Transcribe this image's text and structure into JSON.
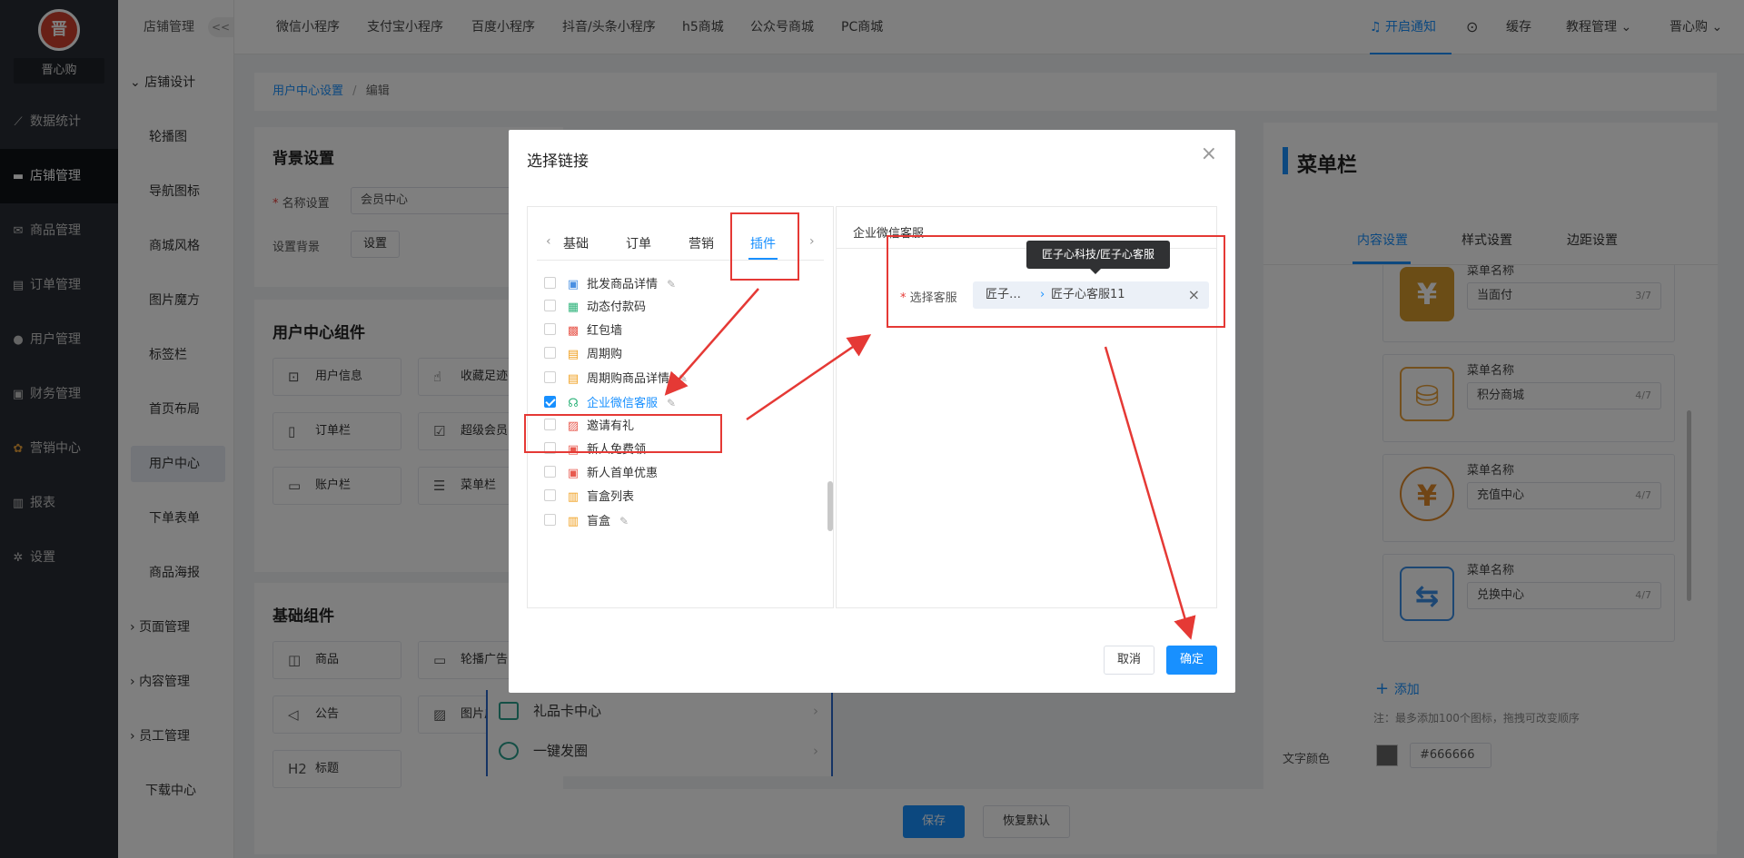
{
  "sidebar_main": {
    "logo_text": "晋",
    "shop_name": "晋心购",
    "items": [
      {
        "label": "数据统计",
        "icon": "chart-line-icon"
      },
      {
        "label": "店铺管理",
        "icon": "shop-icon"
      },
      {
        "label": "商品管理",
        "icon": "goods-icon"
      },
      {
        "label": "订单管理",
        "icon": "order-icon"
      },
      {
        "label": "用户管理",
        "icon": "user-icon"
      },
      {
        "label": "财务管理",
        "icon": "finance-icon"
      },
      {
        "label": "营销中心",
        "icon": "marketing-icon"
      },
      {
        "label": "报表",
        "icon": "report-icon"
      },
      {
        "label": "设置",
        "icon": "settings-icon"
      }
    ]
  },
  "sidebar_sub": {
    "header": "店铺管理",
    "collapse": "<<",
    "group_design": "店铺设计",
    "items": [
      "轮播图",
      "导航图标",
      "商城风格",
      "图片魔方",
      "标签栏",
      "首页布局",
      "用户中心",
      "下单表单",
      "商品海报"
    ],
    "group_page": "页面管理",
    "group_content": "内容管理",
    "group_staff": "员工管理",
    "download": "下载中心"
  },
  "topbar": {
    "tabs": [
      "微信小程序",
      "支付宝小程序",
      "百度小程序",
      "抖音/头条小程序",
      "h5商城",
      "公众号商城",
      "PC商城"
    ],
    "notify": "开启通知",
    "cache": "缓存",
    "tutorial": "教程管理",
    "user": "晋心购"
  },
  "breadcrumb": {
    "parent": "用户中心设置",
    "sep": "/",
    "current": "编辑"
  },
  "bg_settings": {
    "title": "背景设置",
    "name_label": "名称设置",
    "name_value": "会员中心",
    "bg_label": "设置背景",
    "bg_button": "设置"
  },
  "user_components": {
    "title": "用户中心组件",
    "items": [
      "用户信息",
      "收藏足迹",
      "订单栏",
      "超级会员",
      "账户栏",
      "菜单栏"
    ]
  },
  "basic_components": {
    "title": "基础组件",
    "items": [
      "商品",
      "轮播广告",
      "公告",
      "图片广告",
      "标题"
    ],
    "title_prefix": "H2"
  },
  "phone_menu": [
    {
      "label": "礼品卡中心"
    },
    {
      "label": "一键发圈"
    }
  ],
  "right_panel": {
    "title": "菜单栏",
    "tabs": [
      "内容设置",
      "样式设置",
      "边距设置"
    ],
    "menu_label": "菜单名称",
    "menu_items": [
      {
        "name": "当面付",
        "count": "3/7",
        "icon_char": "¥",
        "color": "#d79a2d"
      },
      {
        "name": "积分商城",
        "count": "4/7",
        "icon_char": "⛁",
        "color": "#e8a03a"
      },
      {
        "name": "充值中心",
        "count": "4/7",
        "icon_char": "¥",
        "color": "#e08a2a"
      },
      {
        "name": "兑换中心",
        "count": "4/7",
        "icon_char": "⇆",
        "color": "#3a8ee6"
      }
    ],
    "add": "添加",
    "note": "注：最多添加100个图标，拖拽可改变顺序",
    "text_color_label": "文字颜色",
    "text_color_value": "#666666"
  },
  "bottom": {
    "save": "保存",
    "reset": "恢复默认"
  },
  "dialog": {
    "title": "选择链接",
    "tabs": [
      "基础",
      "订单",
      "营销",
      "插件"
    ],
    "active_tab": "插件",
    "list": [
      {
        "label": "批发商品详情",
        "checked": false,
        "edit": true
      },
      {
        "label": "动态付款码",
        "checked": false,
        "edit": false
      },
      {
        "label": "红包墙",
        "checked": false,
        "edit": false
      },
      {
        "label": "周期购",
        "checked": false,
        "edit": false
      },
      {
        "label": "周期购商品详情",
        "checked": false,
        "edit": true
      },
      {
        "label": "企业微信客服",
        "checked": true,
        "edit": true
      },
      {
        "label": "邀请有礼",
        "checked": false,
        "edit": false
      },
      {
        "label": "新人免费领",
        "checked": false,
        "edit": false
      },
      {
        "label": "新人首单优惠",
        "checked": false,
        "edit": false
      },
      {
        "label": "盲盒列表",
        "checked": false,
        "edit": false
      },
      {
        "label": "盲盒",
        "checked": false,
        "edit": true
      }
    ],
    "right_title": "企业微信客服",
    "select_label": "选择客服",
    "tag_left": "匠子…",
    "tag_right": "匠子心客服11",
    "tooltip": "匠子心科技/匠子心客服",
    "cancel": "取消",
    "confirm": "确定"
  },
  "colors": {
    "accent": "#1890ff",
    "annotation": "#e53935",
    "sidebar_bg": "#282c34"
  }
}
